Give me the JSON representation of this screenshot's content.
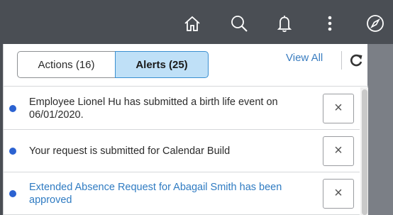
{
  "header": {
    "icons": [
      "home-icon",
      "search-icon",
      "notification-bell-icon",
      "more-options-icon",
      "navbar-compass-icon"
    ]
  },
  "panel": {
    "tabs": [
      {
        "label": "Actions (16)",
        "selected": false
      },
      {
        "label": "Alerts (25)",
        "selected": true
      }
    ],
    "view_all_label": "View All",
    "refresh_icon": "refresh-icon"
  },
  "alerts": [
    {
      "text": "Employee Lionel Hu has submitted a birth life event on 06/01/2020.",
      "unread": true,
      "is_link": false,
      "dismiss": "×"
    },
    {
      "text": "Your request is submitted for Calendar Build",
      "unread": true,
      "is_link": false,
      "dismiss": "×"
    },
    {
      "text": "Extended Absence Request for Abagail Smith has been approved",
      "unread": true,
      "is_link": true,
      "dismiss": "×"
    }
  ],
  "colors": {
    "header_bg": "#4a4e54",
    "unread_dot": "#2b62d1",
    "link": "#2f7bc2",
    "selected_tab_bg": "#bfe0f7"
  }
}
